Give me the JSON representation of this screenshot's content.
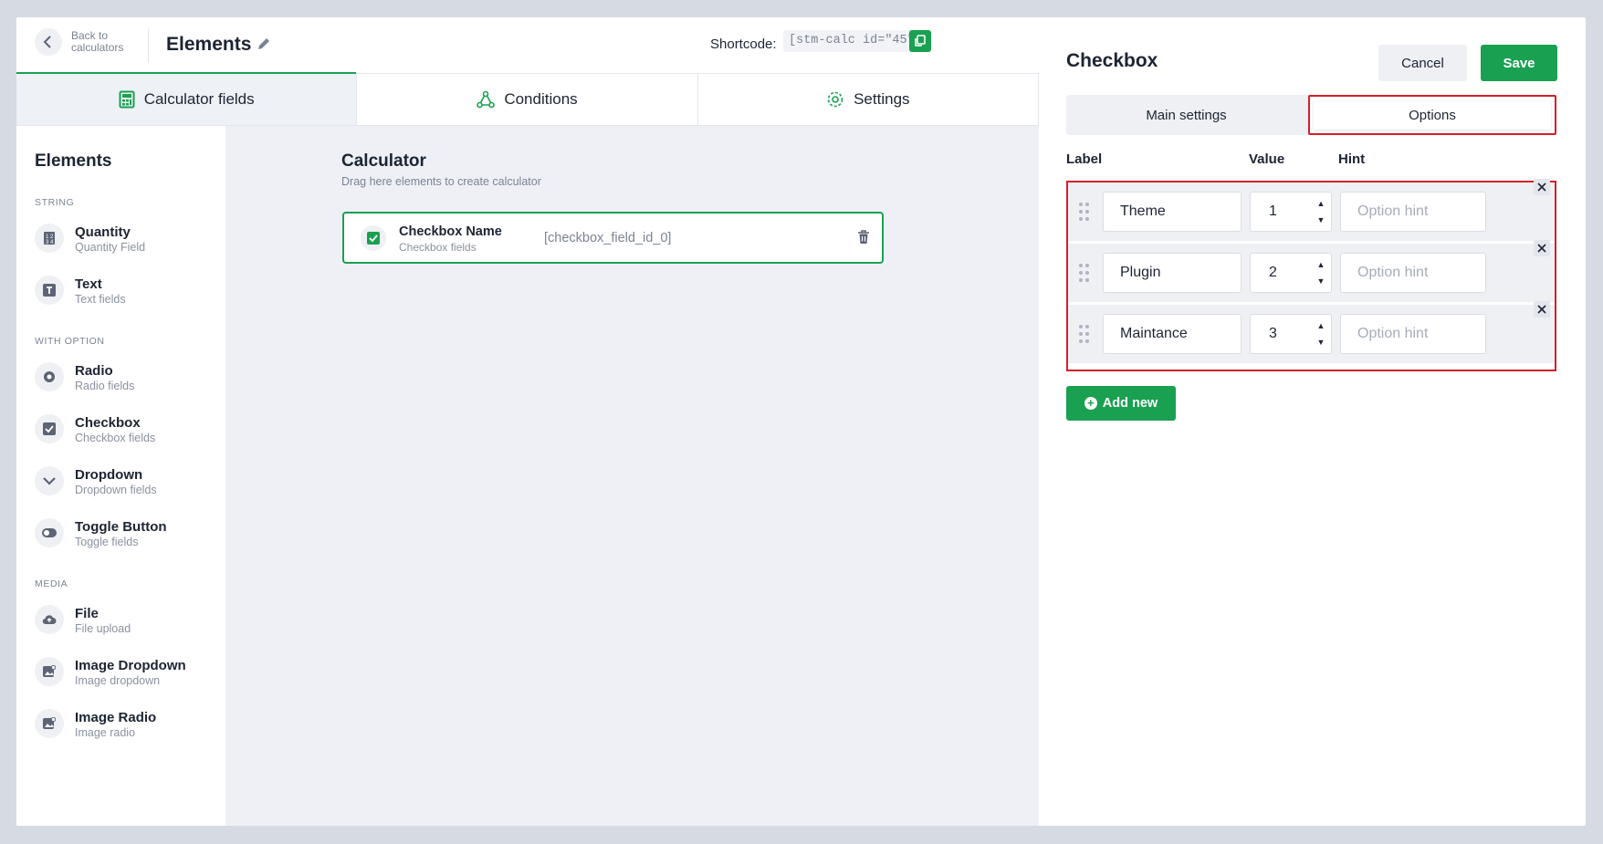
{
  "header": {
    "back_label": "Back to calculators",
    "title": "Elements",
    "shortcode_label": "Shortcode:",
    "shortcode_value": "[stm-calc id=\"45\"]"
  },
  "tabs": [
    {
      "label": "Calculator fields",
      "icon": "calculator-icon",
      "active": true
    },
    {
      "label": "Conditions",
      "icon": "conditions-icon",
      "active": false
    },
    {
      "label": "Settings",
      "icon": "gear-icon",
      "active": false
    }
  ],
  "sidebar": {
    "title": "Elements",
    "groups": [
      {
        "label": "STRING",
        "items": [
          {
            "name": "Quantity",
            "sub": "Quantity Field",
            "icon": "quantity-icon"
          },
          {
            "name": "Text",
            "sub": "Text fields",
            "icon": "text-icon"
          }
        ]
      },
      {
        "label": "WITH OPTION",
        "items": [
          {
            "name": "Radio",
            "sub": "Radio fields",
            "icon": "radio-icon"
          },
          {
            "name": "Checkbox",
            "sub": "Checkbox fields",
            "icon": "checkbox-icon"
          },
          {
            "name": "Dropdown",
            "sub": "Dropdown fields",
            "icon": "chevron-down-icon"
          },
          {
            "name": "Toggle Button",
            "sub": "Toggle fields",
            "icon": "toggle-icon"
          }
        ]
      },
      {
        "label": "MEDIA",
        "items": [
          {
            "name": "File",
            "sub": "File upload",
            "icon": "cloud-upload-icon"
          },
          {
            "name": "Image Dropdown",
            "sub": "Image dropdown",
            "icon": "image-icon"
          },
          {
            "name": "Image Radio",
            "sub": "Image radio",
            "icon": "image-icon"
          }
        ]
      }
    ]
  },
  "canvas": {
    "title": "Calculator",
    "subtitle": "Drag here elements to create calculator",
    "field": {
      "name": "Checkbox Name",
      "sub": "Checkbox fields",
      "id": "[checkbox_field_id_0]"
    }
  },
  "panel": {
    "title": "Checkbox",
    "cancel_label": "Cancel",
    "save_label": "Save",
    "tabs": {
      "main": "Main settings",
      "options": "Options"
    },
    "columns": {
      "label": "Label",
      "value": "Value",
      "hint": "Hint"
    },
    "options": [
      {
        "label": "Theme",
        "value": "1",
        "hint": "",
        "hint_placeholder": "Option hint"
      },
      {
        "label": "Plugin",
        "value": "2",
        "hint": "",
        "hint_placeholder": "Option hint"
      },
      {
        "label": "Maintance",
        "value": "3",
        "hint": "",
        "hint_placeholder": "Option hint"
      }
    ],
    "add_label": "Add new"
  },
  "colors": {
    "accent": "#1aa051",
    "highlight": "#d32029",
    "canvas_bg": "#eef0f6"
  }
}
